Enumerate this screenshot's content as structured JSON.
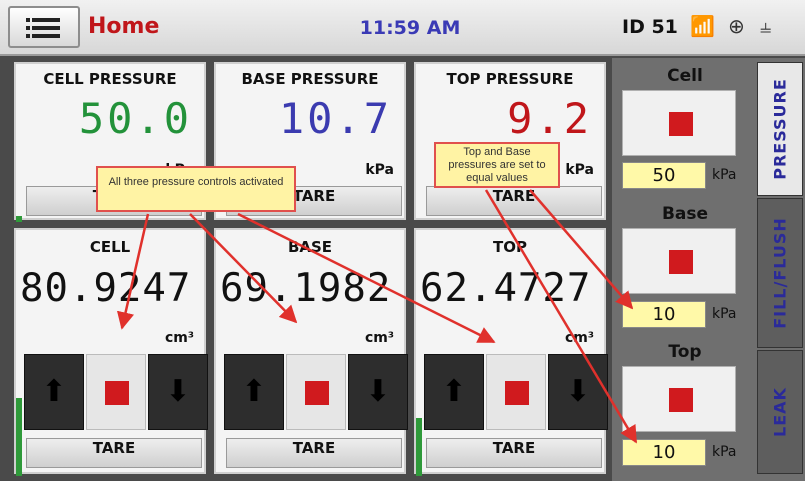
{
  "header": {
    "title": "Home",
    "time": "11:59 AM",
    "device_id": "ID 51",
    "icons": [
      "menu-icon",
      "signal-off-icon",
      "network-icon",
      "usb-icon"
    ]
  },
  "pressure_panels": [
    {
      "label": "CELL PRESSURE",
      "value": "50.0",
      "unit": "kPa",
      "tare": "TARE",
      "color": "#23923a"
    },
    {
      "label": "BASE PRESSURE",
      "value": "10.7",
      "unit": "kPa",
      "tare": "TARE",
      "color": "#3b3bb0"
    },
    {
      "label": "TOP PRESSURE",
      "value": "9.2",
      "unit": "kPa",
      "tare": "TARE",
      "color": "#c0161a"
    }
  ],
  "volume_panels": [
    {
      "label": "CELL",
      "value": "80.9247",
      "unit": "cm³",
      "tare": "TARE"
    },
    {
      "label": "BASE",
      "value": "69.1982",
      "unit": "cm³",
      "tare": "TARE"
    },
    {
      "label": "TOP",
      "value": "62.4727",
      "unit": "cm³",
      "tare": "TARE"
    }
  ],
  "setpoints": [
    {
      "label": "Cell",
      "value": "50",
      "unit": "kPa"
    },
    {
      "label": "Base",
      "value": "10",
      "unit": "kPa"
    },
    {
      "label": "Top",
      "value": "10",
      "unit": "kPa"
    }
  ],
  "tabs": [
    {
      "label": "PRESSURE",
      "active": true
    },
    {
      "label": "FILL/FLUSH",
      "active": false
    },
    {
      "label": "LEAK",
      "active": false
    }
  ],
  "annotations": {
    "left_note": "All three pressure controls activated",
    "right_note": "Top and Base pressures are set to equal values"
  },
  "colors": {
    "accent_red": "#c0161a",
    "stop_red": "#d01a1e",
    "input_yellow": "#fff9a8",
    "arrow_red": "#e0312c"
  }
}
